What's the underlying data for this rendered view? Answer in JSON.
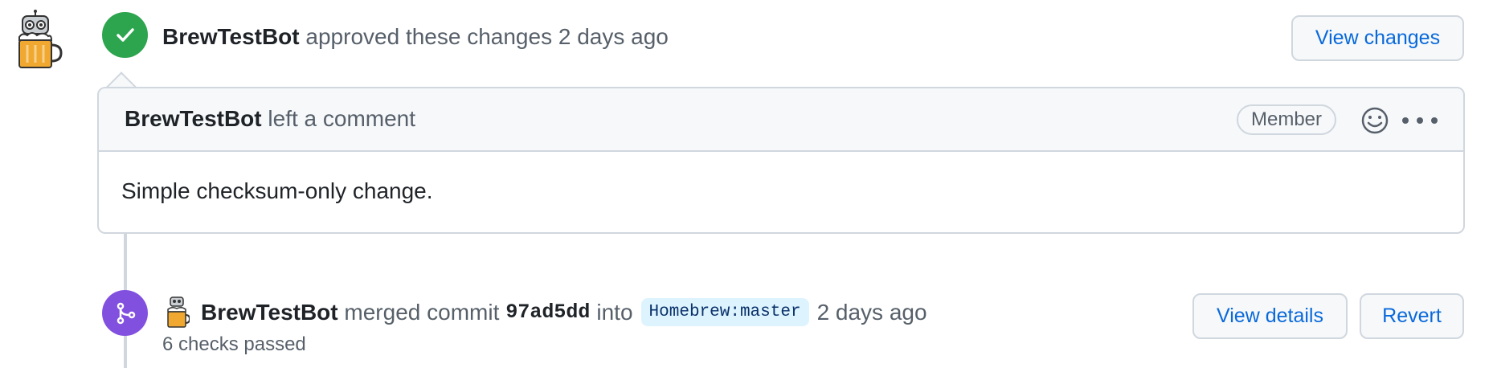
{
  "review": {
    "author": "BrewTestBot",
    "action": "approved these changes",
    "time": "2 days ago",
    "view_changes_label": "View changes"
  },
  "comment": {
    "author": "BrewTestBot",
    "action": "left a comment",
    "role_badge": "Member",
    "body": "Simple checksum-only change."
  },
  "merge": {
    "author": "BrewTestBot",
    "action": "merged commit",
    "commit": "97ad5dd",
    "into": "into",
    "branch": "Homebrew:master",
    "time": "2 days ago",
    "checks": "6 checks passed",
    "view_details_label": "View details",
    "revert_label": "Revert"
  },
  "colors": {
    "approve": "#2da44e",
    "merge": "#8250df",
    "link": "#0969da"
  },
  "icons": {
    "approve": "check-icon",
    "merge": "git-merge-icon",
    "emoji": "smiley-icon",
    "more": "kebab-horizontal-icon"
  }
}
